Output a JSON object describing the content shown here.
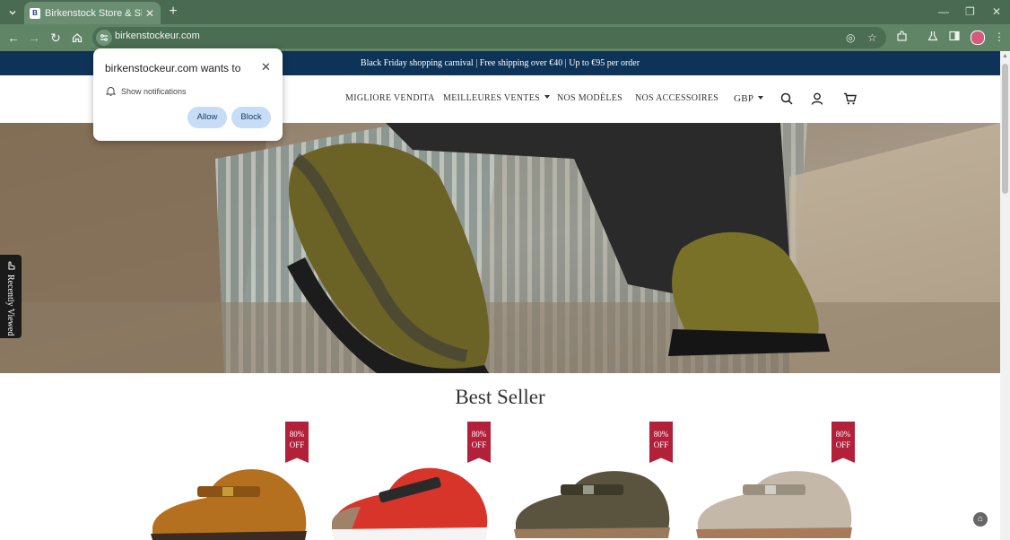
{
  "browser": {
    "tab_title": "Birkenstock Store & Shoes Store",
    "url": "birkenstockeur.com",
    "accent_color": "#5f8466"
  },
  "popup": {
    "title": "birkenstockeur.com wants to",
    "permission": "Show notifications",
    "allow_label": "Allow",
    "block_label": "Block"
  },
  "site": {
    "announcement": "Black Friday shopping carnival | Free shipping over €40 | Up to €95 per order",
    "nav": [
      {
        "label": "MIGLIORE VENDITA"
      },
      {
        "label": "MEILLEURES VENTES"
      },
      {
        "label": "NOS MODÈLES"
      },
      {
        "label": "NOS ACCESSOIRES"
      }
    ],
    "currency": "GBP",
    "recently_viewed": "Recently Viewed",
    "section_title": "Best Seller",
    "products": [
      {
        "badge_line1": "80%",
        "badge_line2": "OFF",
        "color": "#b5701f"
      },
      {
        "badge_line1": "80%",
        "badge_line2": "OFF",
        "color": "#d8352a"
      },
      {
        "badge_line1": "80%",
        "badge_line2": "OFF",
        "color": "#5a543e"
      },
      {
        "badge_line1": "80%",
        "badge_line2": "OFF",
        "color": "#c4b9a8"
      }
    ]
  }
}
